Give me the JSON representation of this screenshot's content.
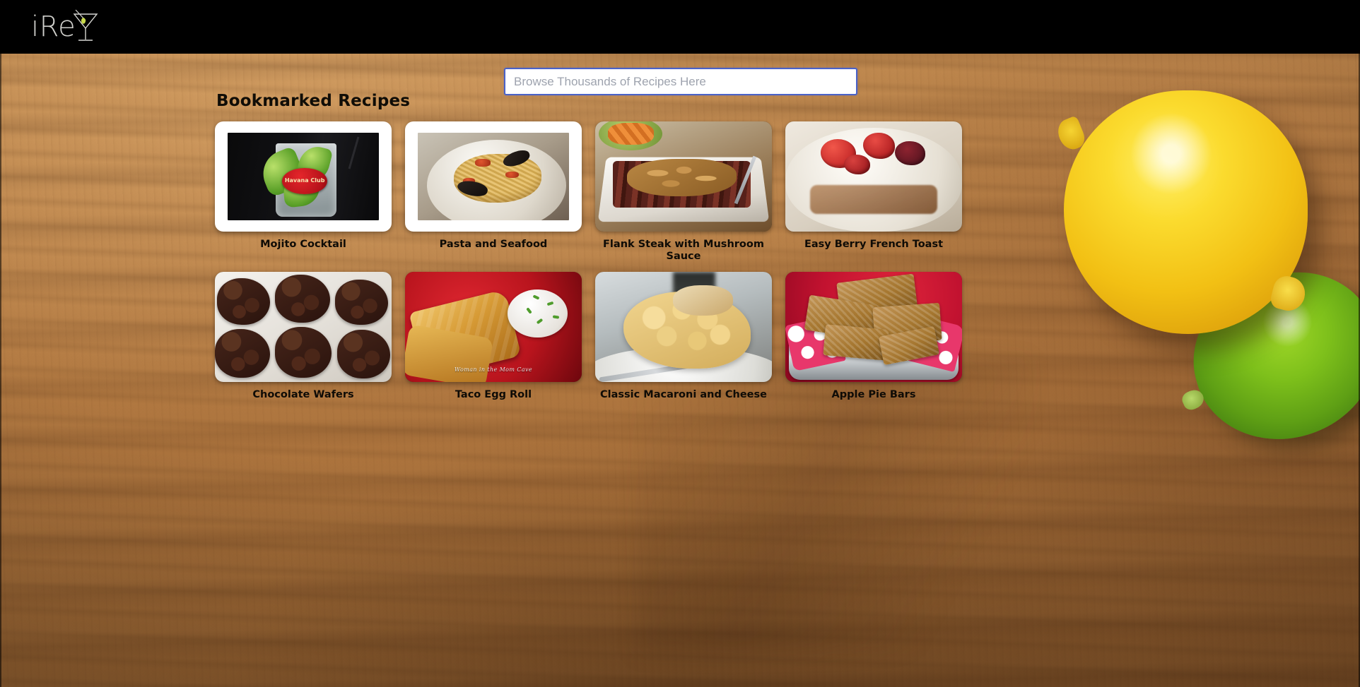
{
  "topbar": {
    "logo_text": "iRe",
    "logo_icon": "martini-glass-icon"
  },
  "search": {
    "placeholder": "Browse Thousands of Recipes Here",
    "value": ""
  },
  "main": {
    "section_title": "Bookmarked Recipes",
    "recipes": [
      {
        "label": "Mojito Cocktail",
        "style": "framed",
        "art": "art-mojito",
        "badge_text": "Havana Club"
      },
      {
        "label": "Pasta and Seafood",
        "style": "framed",
        "art": "art-pasta"
      },
      {
        "label": "Flank Steak with Mushroom Sauce",
        "style": "plain",
        "art": "art-steak"
      },
      {
        "label": "Easy Berry French Toast",
        "style": "plain",
        "art": "art-toast"
      },
      {
        "label": "Chocolate Wafers",
        "style": "plain",
        "art": "art-wafers"
      },
      {
        "label": "Taco Egg Roll",
        "style": "plain",
        "art": "art-tacoroll",
        "watermark": "Woman in the Mom Cave"
      },
      {
        "label": "Classic Macaroni and Cheese",
        "style": "plain",
        "art": "art-mac"
      },
      {
        "label": "Apple Pie Bars",
        "style": "plain",
        "art": "art-applebars"
      }
    ]
  },
  "decor": {
    "lemon": "lemon-image",
    "lime": "lime-image",
    "background": "wooden-cutting-board"
  },
  "colors": {
    "topbar_bg": "#000000",
    "logo_text": "#cfcfcb",
    "olive": "#c8d94a",
    "search_border_focus": "#4a62c8",
    "board_wood": "#ad743d",
    "title_text": "#100d07"
  }
}
